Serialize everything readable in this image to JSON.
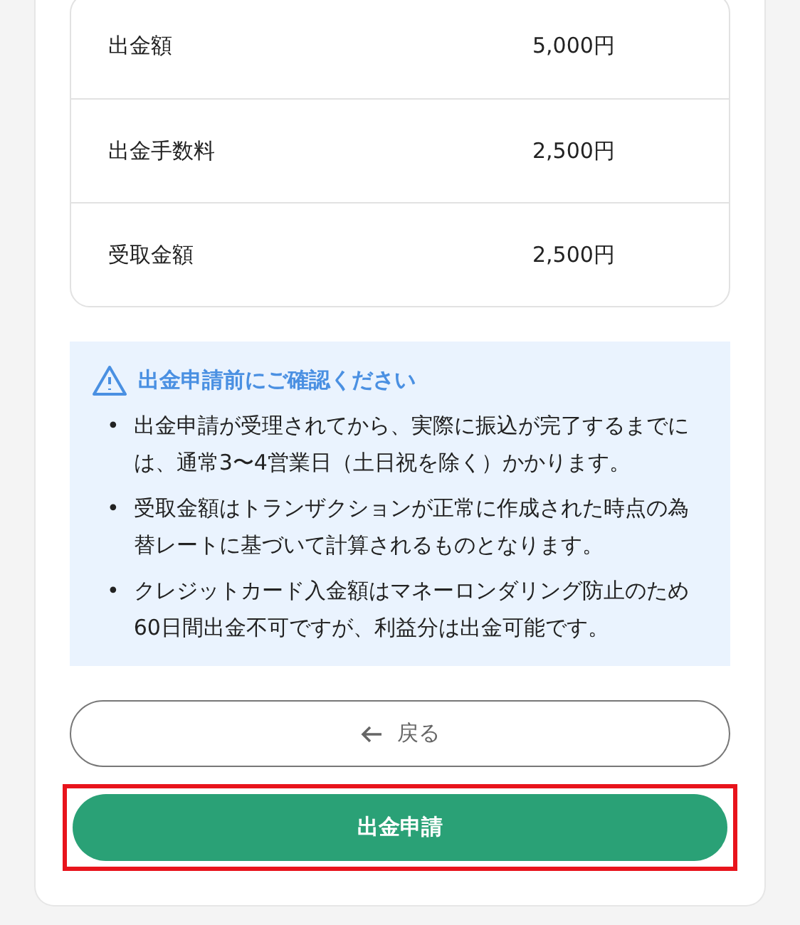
{
  "summary": {
    "rows": [
      {
        "label": "出金額",
        "value": "5,000円"
      },
      {
        "label": "出金手数料",
        "value": "2,500円"
      },
      {
        "label": "受取金額",
        "value": "2,500円"
      }
    ]
  },
  "notice": {
    "title": "出金申請前にご確認ください",
    "items": [
      {
        "bullet": "•",
        "text": "出金申請が受理されてから、実際に振込が完了するまでには、通常3〜4営業日（土日祝を除く）かかります。"
      },
      {
        "bullet": "•",
        "text": "受取金額はトランザクションが正常に作成された時点の為替レートに基づいて計算されるものとなります。"
      },
      {
        "bullet": "•",
        "text": "クレジットカード入金額はマネーロンダリング防止のため60日間出金不可ですが、利益分は出金可能です。"
      }
    ]
  },
  "back_button": {
    "label": "戻る"
  },
  "submit_button": {
    "label": "出金申請",
    "highlighted": true
  }
}
